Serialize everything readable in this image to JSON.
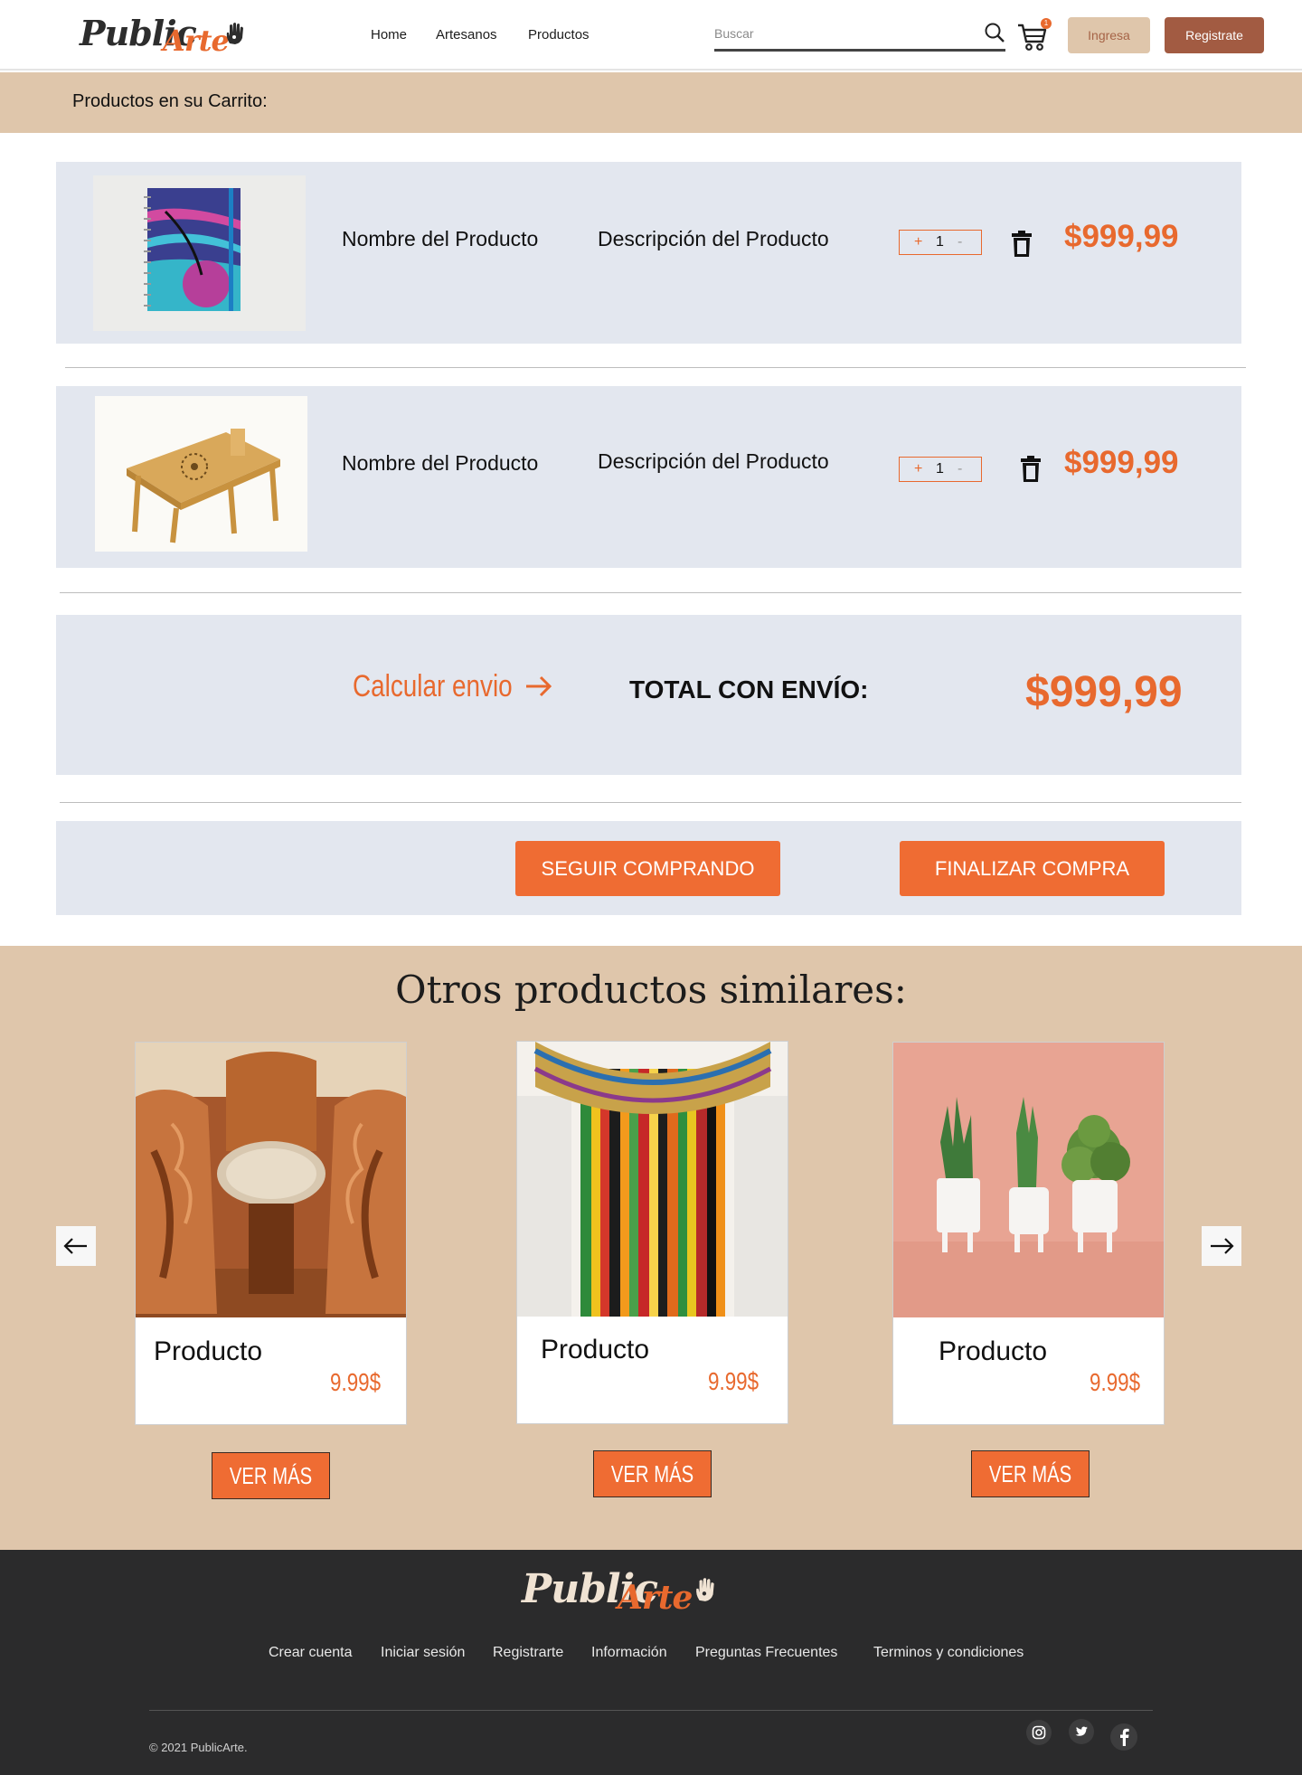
{
  "header": {
    "logo_word1": "Public",
    "logo_word2": "Arte",
    "nav": [
      "Home",
      "Artesanos",
      "Productos"
    ],
    "search_placeholder": "Buscar",
    "cart_count": "1",
    "login_label": "Ingresa",
    "register_label": "Registrate"
  },
  "cart": {
    "title": "Productos en su Carrito:",
    "items": [
      {
        "name": "Nombre del Producto",
        "description": "Descripción del Producto",
        "qty_plus": "+",
        "quantity": "1",
        "qty_minus": "-",
        "price": "$999,99",
        "image": "notebook"
      },
      {
        "name": "Nombre del Producto",
        "description": "Descripción del Producto",
        "qty_plus": "+",
        "quantity": "1",
        "qty_minus": "-",
        "price": "$999,99",
        "image": "bamboo-table"
      }
    ]
  },
  "totals": {
    "calc_shipping": "Calcular envio",
    "total_label": "TOTAL CON ENVÍO:",
    "total_price": "$999,99"
  },
  "actions": {
    "continue_label": "SEGUIR COMPRANDO",
    "finish_label": "FINALIZAR COMPRA"
  },
  "similar": {
    "title": "Otros productos similares:",
    "products": [
      {
        "name": "Producto",
        "price": "9.99$",
        "button": "VER MÁS",
        "image": "carved-wood-furniture"
      },
      {
        "name": "Producto",
        "price": "9.99$",
        "button": "VER MÁS",
        "image": "striped-textile"
      },
      {
        "name": "Producto",
        "price": "9.99$",
        "button": "VER MÁS",
        "image": "cactus-planters"
      }
    ]
  },
  "footer": {
    "logo_word1": "Public",
    "logo_word2": "Arte",
    "links": [
      "Crear cuenta",
      "Iniciar sesión",
      "Registrarte",
      "Información",
      "Preguntas Frecuentes",
      "Terminos y condiciones"
    ],
    "copyright": "© 2021 PublicArte.",
    "social": [
      "instagram-icon",
      "twitter-icon",
      "facebook-icon"
    ]
  },
  "colors": {
    "accent": "#e8692e",
    "beige": "#dfc6ab",
    "brown": "#a25b42",
    "panel": "#e3e7ef",
    "footer": "#2b2b2c"
  }
}
